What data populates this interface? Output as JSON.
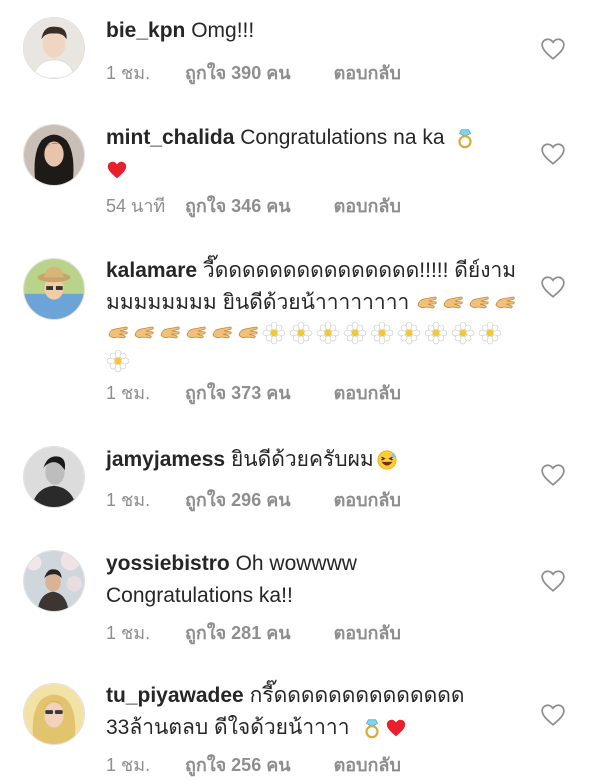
{
  "comments": [
    {
      "username": "bie_kpn",
      "text": "Omg!!!",
      "time": "1 ชม.",
      "likes_label": "ถูกใจ",
      "likes_count": "390",
      "likes_unit": "คน",
      "reply": "ตอบกลับ",
      "avatar_icon": "avatar-man-icon"
    },
    {
      "username": "mint_chalida",
      "text": "Congratulations na ka",
      "time": "54 นาที",
      "likes_label": "ถูกใจ",
      "likes_count": "346",
      "likes_unit": "คน",
      "reply": "ตอบกลับ",
      "emojis": [
        "ring-icon",
        "red-heart-icon"
      ]
    },
    {
      "username": "kalamare",
      "text": "วี๊ดดดดดดดดดดดดดดด!!!!! ดีย์งามมมมมมมมม ยินดีด้วยน้าาาาาาาา",
      "time": "1 ชม.",
      "likes_label": "ถูกใจ",
      "likes_count": "373",
      "likes_unit": "คน",
      "reply": "ตอบกลับ",
      "emojis": [
        "clapping-hands-icon",
        "blossom-icon"
      ]
    },
    {
      "username": "jamyjamess",
      "text": "ยินดีด้วยครับผม",
      "time": "1 ชม.",
      "likes_label": "ถูกใจ",
      "likes_count": "296",
      "likes_unit": "คน",
      "reply": "ตอบกลับ",
      "emojis": [
        "laughing-face-icon"
      ]
    },
    {
      "username": "yossiebistro",
      "text": "Oh wowwww",
      "text2": "Congratulations ka!!",
      "time": "1 ชม.",
      "likes_label": "ถูกใจ",
      "likes_count": "281",
      "likes_unit": "คน",
      "reply": "ตอบกลับ"
    },
    {
      "username": "tu_piyawadee",
      "text": "กรี๊ดดดดดดดดดดดดดด",
      "text2": "33ล้านตลบ ดีใจด้วยน้าาาา",
      "time": "1 ชม.",
      "likes_label": "ถูกใจ",
      "likes_count": "256",
      "likes_unit": "คน",
      "reply": "ตอบกลับ",
      "emojis": [
        "ring-icon",
        "red-heart-icon"
      ]
    }
  ],
  "colors": {
    "text": "#262626",
    "meta": "#8e8e8e",
    "heart_outline": "#8e8e8e"
  }
}
